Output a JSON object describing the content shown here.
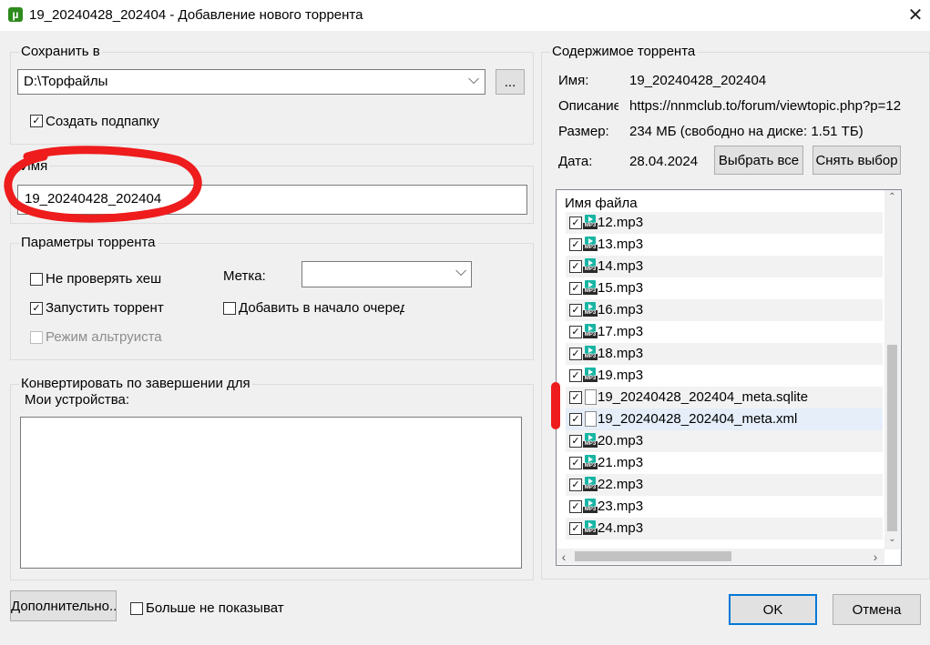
{
  "window": {
    "title": "19_20240428_202404 - Добавление нового торрента",
    "app_icon": "utorrent-icon",
    "close_glyph": "✕"
  },
  "save_in": {
    "legend": "Сохранить в",
    "path": "D:\\Торфайлы",
    "browse_label": "...",
    "create_subfolder_label": "Создать подпапку",
    "create_subfolder_checked": true
  },
  "name_group": {
    "legend": "Имя",
    "value": "19_20240428_202404"
  },
  "params": {
    "legend": "Параметры торрента",
    "skip_hash_label": "Не проверять хеш",
    "skip_hash_checked": false,
    "start_label": "Запустить торрент",
    "start_checked": true,
    "altruist_label": "Режим альтруиста",
    "altruist_enabled": false,
    "label_caption": "Метка:",
    "label_value": "",
    "queue_top_label": "Добавить в начало очеред",
    "queue_top_checked": false
  },
  "convert": {
    "legend": "Конвертировать по завершении для",
    "devices_label": "Мои устройства:"
  },
  "contents": {
    "legend": "Содержимое торрента",
    "name_label": "Имя:",
    "name_value": "19_20240428_202404",
    "desc_label": "Описание",
    "desc_value": "https://nnmclub.to/forum/viewtopic.php?p=12",
    "size_label": "Размер:",
    "size_value": "234 МБ (свободно на диске: 1.51 ТБ)",
    "date_label": "Дата:",
    "date_value": "28.04.2024",
    "select_all_label": "Выбрать все",
    "deselect_label": "Снять выбор",
    "column_header": "Имя файла",
    "files": [
      {
        "name": "12.mp3",
        "type": "mp3",
        "checked": true
      },
      {
        "name": "13.mp3",
        "type": "mp3",
        "checked": true
      },
      {
        "name": "14.mp3",
        "type": "mp3",
        "checked": true
      },
      {
        "name": "15.mp3",
        "type": "mp3",
        "checked": true
      },
      {
        "name": "16.mp3",
        "type": "mp3",
        "checked": true
      },
      {
        "name": "17.mp3",
        "type": "mp3",
        "checked": true
      },
      {
        "name": "18.mp3",
        "type": "mp3",
        "checked": true
      },
      {
        "name": "19.mp3",
        "type": "mp3",
        "checked": true
      },
      {
        "name": "19_20240428_202404_meta.sqlite",
        "type": "file",
        "checked": true
      },
      {
        "name": "19_20240428_202404_meta.xml",
        "type": "file",
        "checked": true,
        "selected": true
      },
      {
        "name": "20.mp3",
        "type": "mp3",
        "checked": true
      },
      {
        "name": "21.mp3",
        "type": "mp3",
        "checked": true
      },
      {
        "name": "22.mp3",
        "type": "mp3",
        "checked": true
      },
      {
        "name": "23.mp3",
        "type": "mp3",
        "checked": true
      },
      {
        "name": "24.mp3",
        "type": "mp3",
        "checked": true
      }
    ],
    "mp3_tag": "MP3"
  },
  "footer": {
    "advanced_label": "Дополнительно...",
    "dont_show_label": "Больше не показыват",
    "dont_show_checked": false,
    "ok_label": "OK",
    "cancel_label": "Отмена"
  },
  "annotations": {
    "color": "#ee1c1c"
  },
  "glyphs": {
    "check": "✓",
    "dropdown": "⌵",
    "up": "⌃",
    "down": "⌄",
    "left": "‹",
    "right": "›"
  }
}
